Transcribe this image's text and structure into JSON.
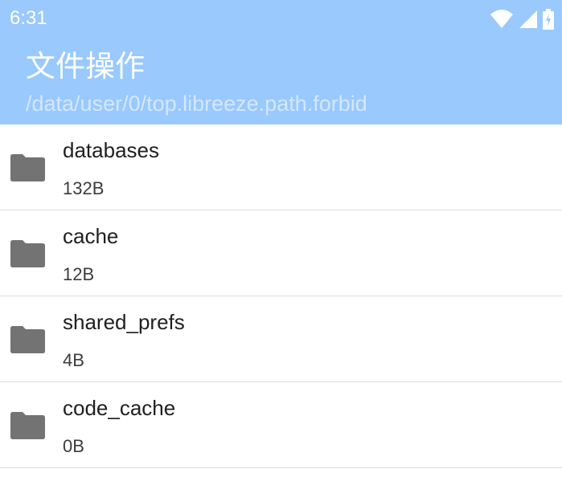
{
  "status_bar": {
    "time": "6:31",
    "icons": [
      "wifi-icon",
      "signal-icon",
      "battery-charging-icon"
    ]
  },
  "app_bar": {
    "title": "文件操作",
    "path": "/data/user/0/top.libreeze.path.forbid",
    "background_color": "#99c9fd"
  },
  "files": [
    {
      "name": "databases",
      "size": "132B",
      "icon": "folder-icon"
    },
    {
      "name": "cache",
      "size": "12B",
      "icon": "folder-icon"
    },
    {
      "name": "shared_prefs",
      "size": "4B",
      "icon": "folder-icon"
    },
    {
      "name": "code_cache",
      "size": "0B",
      "icon": "folder-icon"
    }
  ]
}
